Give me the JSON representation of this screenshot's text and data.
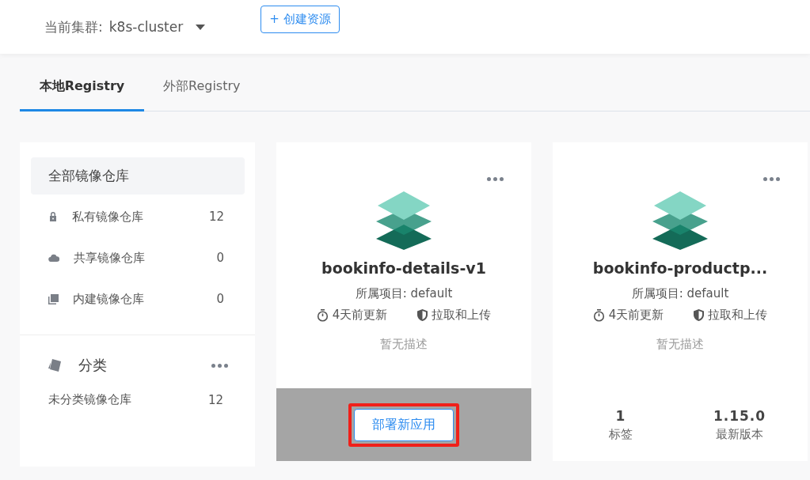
{
  "header": {
    "cluster_label": "当前集群:",
    "cluster_value": "k8s-cluster",
    "create_button": "+ 创建资源"
  },
  "tabs": [
    {
      "label": "本地Registry",
      "selected": true
    },
    {
      "label": "外部Registry",
      "selected": false
    }
  ],
  "sidebar": {
    "items": [
      {
        "kind": "all",
        "label": "全部镜像仓库",
        "selected": true
      },
      {
        "kind": "private",
        "label": "私有镜像仓库",
        "count": "12",
        "selected": false
      },
      {
        "kind": "shared",
        "label": "共享镜像仓库",
        "count": "0",
        "selected": false
      },
      {
        "kind": "builtin",
        "label": "内建镜像仓库",
        "count": "0",
        "selected": false
      }
    ],
    "category": {
      "title": "分类",
      "items": [
        {
          "label": "未分类镜像仓库",
          "count": "12"
        }
      ]
    }
  },
  "cards": [
    {
      "name": "bookinfo-details-v1",
      "project": "所属项目: default",
      "updated": "4天前更新",
      "permission": "拉取和上传",
      "description": "暂无描述",
      "overlay": {
        "button": "部署新应用",
        "highlighted": true
      }
    },
    {
      "name": "bookinfo-productp...",
      "project": "所属项目: default",
      "updated": "4天前更新",
      "permission": "拉取和上传",
      "description": "暂无描述",
      "stats": [
        {
          "value": "1",
          "label": "标签"
        },
        {
          "value": "1.15.0",
          "label": "最新版本"
        }
      ]
    }
  ]
}
